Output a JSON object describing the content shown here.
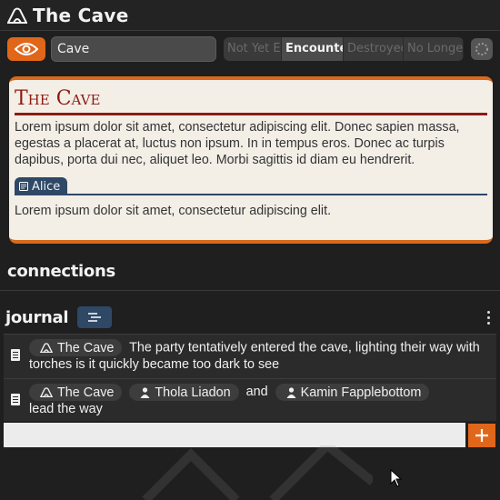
{
  "app": {
    "title": "The Cave",
    "icon": "cave-icon"
  },
  "toolbar": {
    "visibility_icon": "eye-icon",
    "name_value": "Cave",
    "statuses": [
      "Not Yet Encountered",
      "Encountered",
      "Destroyed",
      "No Longer Exists"
    ],
    "active_status": "Encountered",
    "spinner_icon": "spinner-icon"
  },
  "card": {
    "title": "The Cave",
    "description": "Lorem ipsum dolor sit amet, consectetur adipiscing elit. Donec sapien massa, egestas a placerat at, luctus non ipsum. In in tempus eros. Donec ac turpis dapibus, porta dui nec, aliquet leo. Morbi sagittis id diam eu hendrerit.",
    "tab_label": "Alice",
    "tab_content": "Lorem ipsum dolor sit amet, consectetur adipiscing elit."
  },
  "connections": {
    "title": "connections"
  },
  "journal": {
    "title": "journal",
    "entries": [
      {
        "chips": [
          "The Cave"
        ],
        "text": "The party tentatively entered the cave, lighting their way with torches is it quickly became too dark to see"
      },
      {
        "chips": [
          "The Cave",
          "Thola Liadon"
        ],
        "connector": "and",
        "chip3": "Kamin Fapplebottom",
        "text": "lead the way"
      }
    ],
    "input_value": ""
  },
  "colors": {
    "accent": "#e0661a",
    "title_red": "#8e1a12",
    "tab_blue": "#2e4866",
    "parchment": "#f3efe7"
  }
}
